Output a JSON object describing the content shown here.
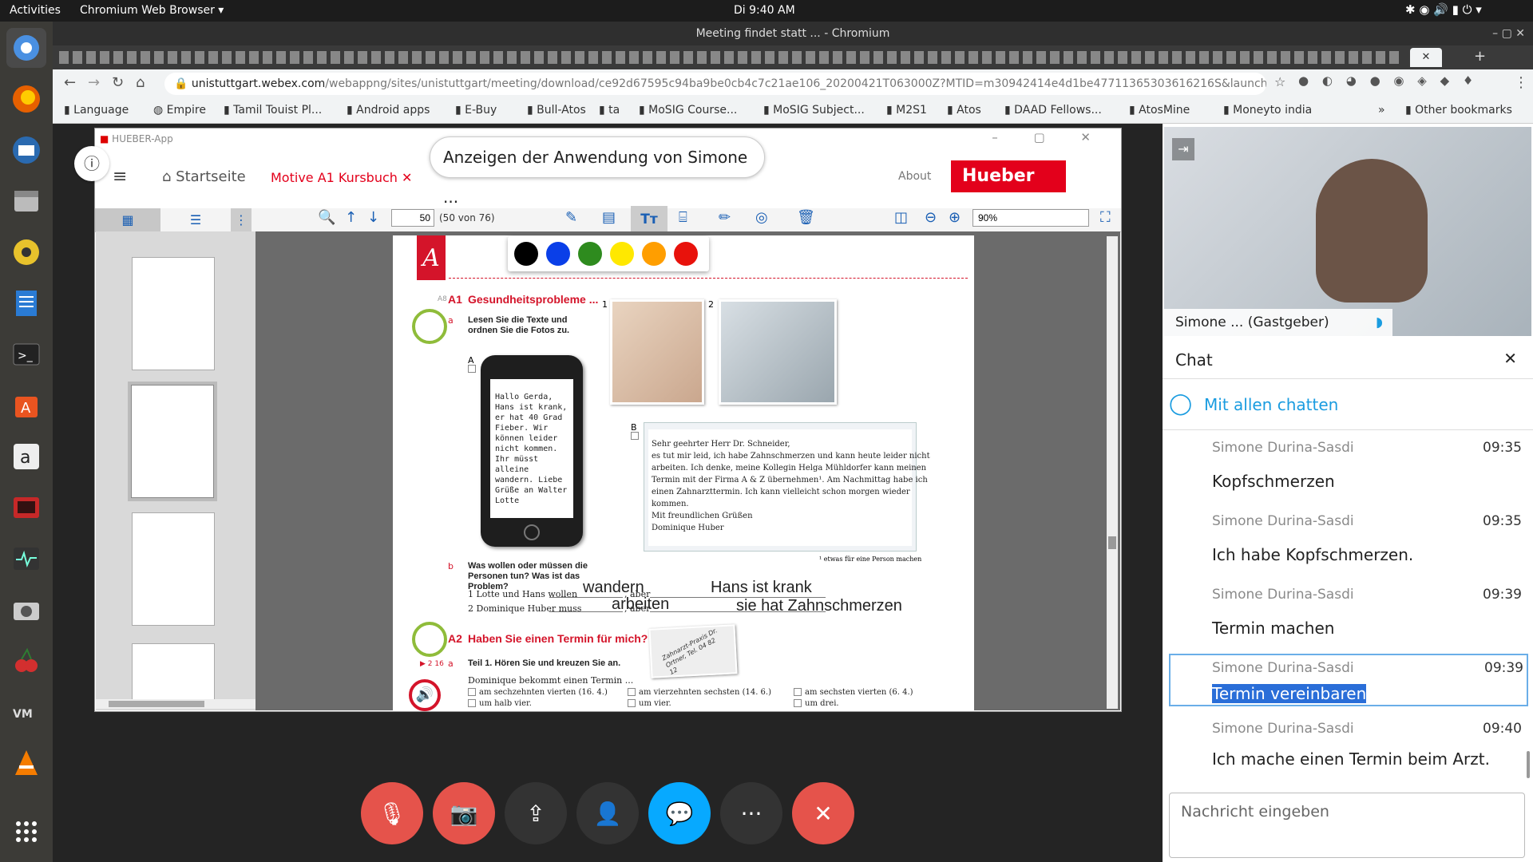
{
  "ubuntu": {
    "activities": "Activities",
    "app_menu": "Chromium Web Browser",
    "clock": "Di  9:40 AM"
  },
  "browser": {
    "window_title": "Meeting findet statt ... - Chromium",
    "url_host": "unistuttgart.webex.com",
    "url_path": "/webappng/sites/unistuttgart/meeting/download/ce92d67595c94ba9be0cb4c7c21ae106_20200421T063000Z?MTID=m30942414e4d1be47711365303616216S&launchApp...",
    "bookmarks": [
      "Language",
      "Empire",
      "Tamil Touist Pl...",
      "Android apps",
      "E-Buy",
      "Bull-Atos",
      "ta",
      "MoSIG Course...",
      "MoSIG Subject...",
      "M2S1",
      "Atos",
      "DAAD Fellows...",
      "AtosMine",
      "Moneyto india"
    ],
    "other_bookmarks": "Other bookmarks"
  },
  "hueber": {
    "app_title": "HUEBER-App",
    "share_banner": "Anzeigen der Anwendung von Simone ...",
    "home": "Startseite",
    "book_tab": "Motive A1 Kursbuch",
    "about": "About",
    "logo": "Hueber",
    "page_input": "50",
    "page_count": "(50 von 76)",
    "zoom": "90%",
    "colors": [
      "#000000",
      "#0a3fe8",
      "#2e8b1e",
      "#ffe800",
      "#ff9e00",
      "#e8120c"
    ]
  },
  "page": {
    "section_letter": "A",
    "a1_num": "A1",
    "a1_title": "Gesundheitsprobleme ...",
    "a1_a": "a",
    "a1_instr": "Lesen Sie die Texte und ordnen Sie die Fotos zu.",
    "photo1": "1",
    "photo2": "2",
    "label_a": "A",
    "label_b": "B",
    "sms": "Hallo Gerda, Hans ist krank, er hat 40 Grad Fieber. Wir können leider nicht kommen. Ihr müsst alleine wandern. Liebe Grüße an Walter Lotte",
    "letter_l1": "Sehr geehrter Herr Dr. Schneider,",
    "letter_l2": "es tut mir leid, ich habe Zahnschmerzen und kann heute leider nicht",
    "letter_l3": "arbeiten. Ich denke, meine Kollegin Helga Mühldorfer kann meinen",
    "letter_l4": "Termin mit der Firma A & Z übernehmen¹. Am Nachmittag habe ich",
    "letter_l5": "einen Zahnarzttermin. Ich kann vielleicht schon morgen wieder",
    "letter_l6": "kommen.",
    "letter_l7": "Mit freundlichen Grüßen",
    "letter_l8": "Dominique Huber",
    "footnote": "¹ etwas für eine Person machen",
    "b_letter": "b",
    "b_instr": "Was wollen oder müssen die Personen tun? Was ist das Problem?",
    "row1": "1  Lotte und Hans wollen",
    "row2": "2  Dominique Huber muss",
    "aber": ", aber",
    "ans1a": "wandern",
    "ans1b": "Hans ist krank",
    "ans2a": "arbeiten",
    "ans2b": "sie hat Zahnschmerzen",
    "a2_num": "A2",
    "a2_title": "Haben Sie einen Termin für mich?",
    "a2_a": "a",
    "a2_track": "2 16",
    "a2_instr": "Teil 1. Hören Sie und kreuzen Sie an.",
    "card": "Zahnarzt-Praxis Dr. Ortner, Tel. 04 82 12",
    "a2_q": "Dominique bekommt einen Termin ...",
    "opt1": "am sechzehnten vierten (16. 4.)",
    "opt2": "am vierzehnten sechsten (14. 6.)",
    "opt3": "am sechsten vierten (6. 4.)",
    "opt4": "um halb vier.",
    "opt5": "um vier.",
    "opt6": "um drei."
  },
  "webex": {
    "video_name": "Simone ...",
    "video_role": "(Gastgeber)",
    "chat_title": "Chat",
    "chat_scope": "Mit allen chatten",
    "messages": [
      {
        "name": "Simone Durina-Sasdi",
        "time": "09:35",
        "text": "Kopfschmerzen"
      },
      {
        "name": "Simone Durina-Sasdi",
        "time": "09:35",
        "text": "Ich habe Kopfschmerzen."
      },
      {
        "name": "Simone Durina-Sasdi",
        "time": "09:39",
        "text": "Termin machen"
      },
      {
        "name": "Simone Durina-Sasdi",
        "time": "09:39",
        "text": "Termin vereinbaren"
      },
      {
        "name": "Simone Durina-Sasdi",
        "time": "09:40",
        "text": "Ich mache einen Termin beim Arzt."
      }
    ],
    "input_placeholder": "Nachricht eingeben"
  }
}
